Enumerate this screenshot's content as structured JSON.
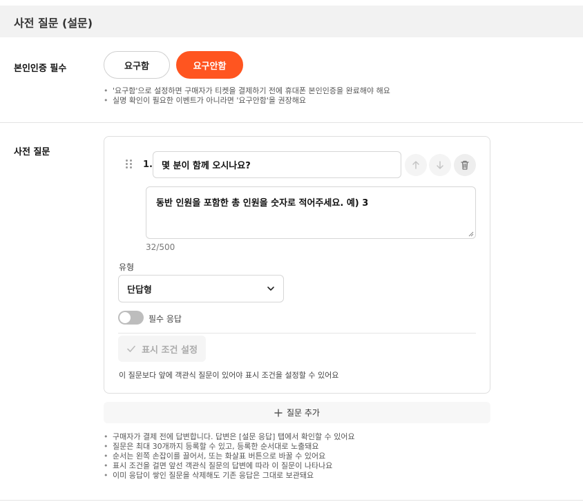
{
  "section": {
    "title": "사전 질문 (설문)"
  },
  "identity": {
    "label": "본인인증 필수",
    "options": [
      {
        "label": "요구함",
        "selected": false
      },
      {
        "label": "요구안함",
        "selected": true
      }
    ],
    "notes": [
      "'요구함'으로 설정하면 구매자가 티켓을 결제하기 전에 휴대폰 본인인증을 완료해야 해요",
      "실명 확인이 필요한 이벤트가 아니라면 '요구안함'을 권장해요"
    ]
  },
  "questions": {
    "label": "사전 질문",
    "items": [
      {
        "number": "1.",
        "title": "몇 분이 함께 오시나요?",
        "description": "동반 인원을 포함한 총 인원을 숫자로 적어주세요. 예) 3",
        "char_count": "32/500",
        "type_label": "유형",
        "type_value": "단답형",
        "required_label": "필수 응답",
        "required": false,
        "condition_button": "표시 조건 설정",
        "condition_hint": "이 질문보다 앞에 객관식 질문이 있어야 표시 조건을 설정할 수 있어요"
      }
    ],
    "add_button": "질문 추가",
    "notes": [
      "구매자가 결제 전에 답변합니다. 답변은 [설문 응답] 탭에서 확인할 수 있어요",
      "질문은 최대 30개까지 등록할 수 있고, 등록한 순서대로 노출돼요",
      "순서는 왼쪽 손잡이를 끌어서, 또는 화살표 버튼으로 바꿀 수 있어요",
      "표시 조건을 걸면 앞선 객관식 질문의 답변에 따라 이 질문이 나타나요",
      "이미 응답이 쌓인 질문을 삭제해도 기존 응답은 그대로 보관돼요"
    ]
  },
  "colors": {
    "accent": "#ff5520",
    "header_bg": "#f2f2f2",
    "toggle_off": "#bdbdbd"
  },
  "icons": {
    "drag": "drag-handle-icon",
    "up": "arrow-up-icon",
    "down": "arrow-down-icon",
    "delete": "trash-icon",
    "select": "chevron-down-icon",
    "check": "check-icon",
    "add": "plus-icon"
  }
}
